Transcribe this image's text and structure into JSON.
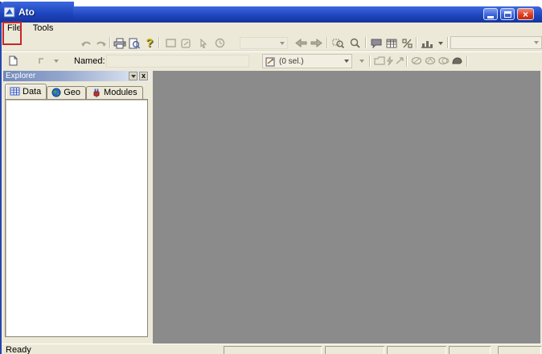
{
  "window": {
    "title": "Ato",
    "controls": {
      "minimize": "minimize",
      "maximize": "maximize",
      "close_glyph": "×"
    }
  },
  "menubar": {
    "items": [
      {
        "label": "File"
      },
      {
        "label": "Tools"
      }
    ]
  },
  "annotation": {
    "type": "highlight-box",
    "target": "file-menu",
    "color": "#c62828"
  },
  "toolbar_primary": {
    "help_glyph": "?",
    "combo_view_value": "",
    "combo_right_value": "",
    "icons": [
      "undo",
      "redo",
      "print",
      "print-preview",
      "help",
      "rectangle-tool",
      "shape-tool",
      "pointer-tool",
      "clock-tool",
      "back",
      "forward",
      "zoom-window",
      "zoom",
      "comment",
      "table",
      "percent",
      "chart"
    ]
  },
  "toolbar_secondary": {
    "named_label": "Named:",
    "named_value": "",
    "zone_combo_value": "(0 sel.)",
    "icons": [
      "new-document",
      "dim-tool",
      "zone",
      "folder-tool",
      "flash-tool",
      "pointer-tool",
      "draw-tool-1",
      "draw-tool-2",
      "draw-tool-3",
      "filled-tool"
    ]
  },
  "explorer": {
    "title": "Explorer",
    "close_glyph": "x",
    "tabs": [
      {
        "label": "Data",
        "icon": "table-grid"
      },
      {
        "label": "Geo",
        "icon": "globe"
      },
      {
        "label": "Modules",
        "icon": "plug"
      }
    ],
    "active_tab": "Data"
  },
  "statusbar": {
    "message": "Ready",
    "panel_count": 5
  },
  "colors": {
    "titlebar_blue": "#1e46c0",
    "close_red": "#da3a1e",
    "chrome_beige": "#ece9d8",
    "canvas_gray": "#8b8b8b",
    "annotation_red": "#c62828",
    "explorer_header_blue": "#7088ba"
  }
}
